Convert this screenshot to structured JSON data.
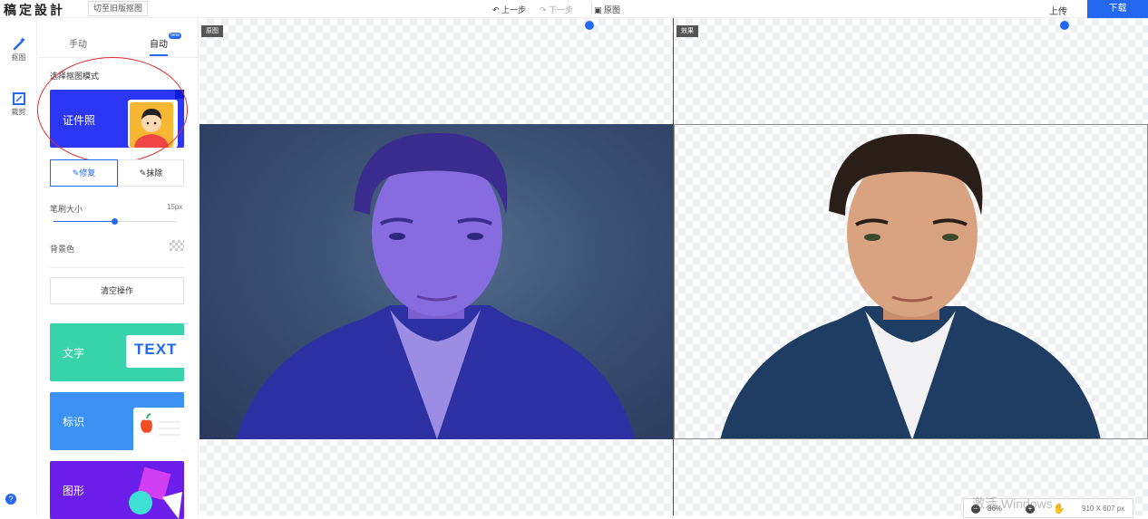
{
  "header": {
    "logo": "稿定設計",
    "old_version_button": "切至旧版抠图",
    "undo_label": "上一步",
    "redo_label": "下一步",
    "original_label": "原图",
    "upload_label": "上传",
    "download_label": "下载"
  },
  "left_rail": {
    "items": [
      {
        "label": "抠图",
        "icon": "magic-wand-icon"
      },
      {
        "label": "裁剪",
        "icon": "crop-icon"
      }
    ],
    "help_icon": "?"
  },
  "panel": {
    "tabs": [
      {
        "label": "手动",
        "active": false
      },
      {
        "label": "自动",
        "active": true,
        "badge": "beta"
      }
    ],
    "section_title": "选择抠图模式",
    "mode_card": {
      "label": "证件照"
    },
    "tools": {
      "repair": "修复",
      "erase": "抹除"
    },
    "brush_size": {
      "label": "笔刷大小",
      "value": "15px",
      "level_fraction": 0.49
    },
    "background_label": "背景色",
    "clear_button": "清空操作",
    "cards": [
      {
        "label": "文字",
        "tile_text": "TEXT",
        "color": "#38d3a9"
      },
      {
        "label": "标识",
        "color": "#3c91f5"
      },
      {
        "label": "图形",
        "color": "#6b1ee9"
      }
    ]
  },
  "canvas": {
    "left_tag": "原图",
    "right_tag": "效果"
  },
  "status": {
    "zoom": "86%",
    "dimensions": "910 X 607 px",
    "watermark": "激活 Windows"
  },
  "colors": {
    "accent": "#2468f2",
    "id_card_bg": "#2b37f5",
    "highlight_circle": "#e12b2b"
  }
}
